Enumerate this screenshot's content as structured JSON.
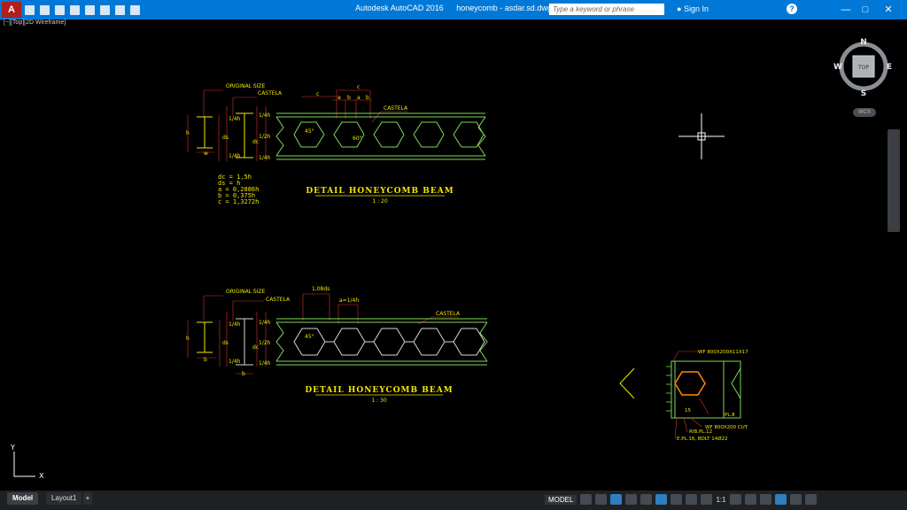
{
  "title_bar": {
    "logo": "A",
    "app_name": "Autodesk AutoCAD 2016",
    "file_name": "honeycomb - asdar.sd.dwg",
    "search_placeholder": "Type a keyword or phrase",
    "sign_in": "Sign In",
    "help": "?"
  },
  "viewport_label": "[−][Top][2D Wireframe]",
  "viewcube": {
    "top": "TOP",
    "north": "N",
    "south": "S",
    "east": "E",
    "west": "W",
    "wcs": "WCS"
  },
  "detail1": {
    "original_size": "ORIGINAL SIZE",
    "castela_left": "CASTELA",
    "castela_right": "CASTELA",
    "dim_c1": "c",
    "dim_c2": "c",
    "dim_a1": "a",
    "dim_b1": "b",
    "dim_a2": "a",
    "dim_b2": "b",
    "dim_h": "h",
    "dim_w": "w",
    "dim_ds": "ds",
    "dim_dc": "dc",
    "dim_1_4h_a": "1/4h",
    "dim_1_4h_b": "1/4h",
    "dim_1_2h": "1/2h",
    "dim_1_4h_c": "1/4h",
    "dim_1_4h_d": "1/4h",
    "dim_45": "45°",
    "dim_60": "60°",
    "formula_lines": [
      "dc  = 1,5h",
      "ds  = h",
      "a   = 0,2886h",
      "b   = 0,375h",
      "c   = 1,3272h"
    ],
    "title": "DETAIL HONEYCOMB BEAM",
    "scale": "1 : 20"
  },
  "detail2": {
    "original_size": "ORIGINAL SIZE",
    "castela_left": "CASTELA",
    "castela_right": "CASTELA",
    "dim_108": "1,08ds",
    "dim_a": "a=1/4h",
    "dim_h": "h",
    "dim_b": "b",
    "dim_ds": "ds",
    "dim_dc": "dc",
    "dim_1_4h_a": "1/4h",
    "dim_1_4h_b": "1/4h",
    "dim_1_2h": "1/2h",
    "dim_1_4h_c": "1/4h",
    "dim_1_4h_d": "1/4h",
    "dim_45": "45°",
    "title": "DETAIL HONEYCOMB BEAM",
    "scale": "1 : 30"
  },
  "connection_detail": {
    "wf_top": "WF 800X200X11X17",
    "pl8": "PL.8",
    "wf_cut": "WF 800X200 CUT",
    "rib": "RIB.PL.12",
    "ep": "E.PL.16, BOLT 14Ø22",
    "dim_15": "15"
  },
  "ucs": {
    "x": "X",
    "y": "Y"
  },
  "layout_tabs": [
    "Model",
    "Layout1",
    "+"
  ],
  "status_bar": {
    "model": "MODEL",
    "scale": "1:1"
  },
  "colors": {
    "title_bar": "#0078d7",
    "background": "#000000",
    "beam_green": "#7ed957",
    "annotation_yellow": "#f2e600",
    "dimension_red": "#e03030",
    "hexagon_white": "#d8d8d8",
    "orange": "#ff8c00"
  }
}
